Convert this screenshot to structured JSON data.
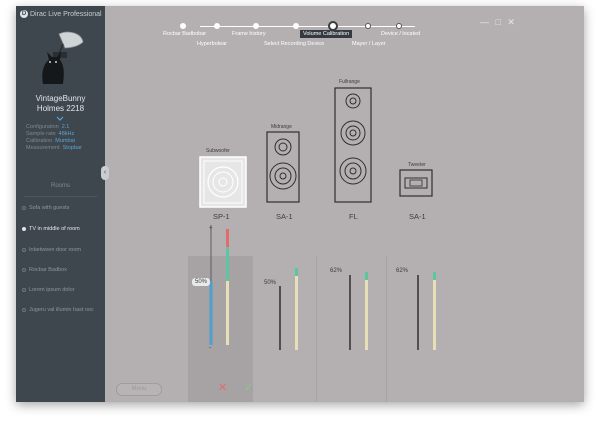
{
  "app": {
    "title": "Dirac Live Professional",
    "logo_glyph": "D"
  },
  "window_controls": "— □ ✕",
  "user": {
    "name_line1": "VintageBunny",
    "name_line2": "Holmes 2218"
  },
  "details": [
    {
      "k": "Configuration",
      "v": "2.1"
    },
    {
      "k": "Sample rate",
      "v": "48kHz"
    },
    {
      "k": "Calibration",
      "v": "Mumbai"
    },
    {
      "k": "Measurement",
      "v": "Stopbar"
    }
  ],
  "rooms": {
    "title": "Rooms",
    "items": [
      {
        "label": "Sofa with guests",
        "selected": false
      },
      {
        "label": "TV in middle of room",
        "selected": true
      },
      {
        "label": "Inbetween door room",
        "selected": false
      },
      {
        "label": "Rocbar Badbox",
        "selected": false
      },
      {
        "label": "Lorem ipsum dolor",
        "selected": false
      },
      {
        "label": "Jugeru val illumin hast noc",
        "selected": false
      }
    ],
    "menu_label": "Menu"
  },
  "steps": {
    "labels": [
      "Rocbar Badbobar",
      "Hyperbolear",
      "Frame history",
      "Select Recording Device",
      "Volume Calibration",
      "Mayer / Layer",
      "Device / located"
    ]
  },
  "speakers": [
    {
      "id": "SP-1",
      "type_label": "Subwoofer",
      "name": "SP-1"
    },
    {
      "id": "SA-1-mid",
      "type_label": "Midrange",
      "name": "SA-1"
    },
    {
      "id": "FL",
      "type_label": "Fullrange",
      "name": "FL"
    },
    {
      "id": "SA-1-tw",
      "type_label": "Tweeter",
      "name": "SA-1"
    }
  ],
  "levels": [
    {
      "label": "50%",
      "value": 0.5
    },
    {
      "label": "50%",
      "value": 0.5
    },
    {
      "label": "62%",
      "value": 0.62
    },
    {
      "label": "62%",
      "value": 0.62
    }
  ],
  "colors": {
    "accent_blue": "#4f9fd1",
    "accent_red": "#e46a6a",
    "accent_green": "#7cd17a",
    "meter_green": "#5bc6a0",
    "sidebar_bg": "#3e474e"
  }
}
